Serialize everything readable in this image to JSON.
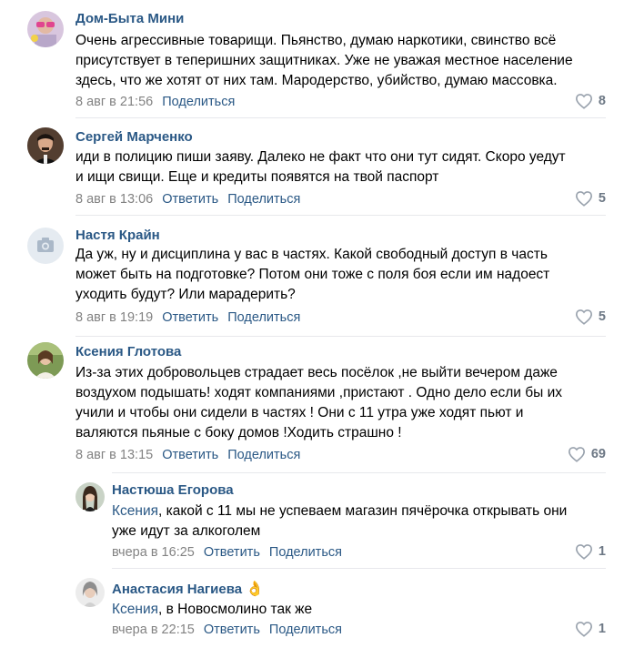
{
  "comments": [
    {
      "author": "Дом-Быта Мини",
      "lines": [
        "Очень агрессивные товарищи. Пьянство, думаю наркотики, свинство всё",
        "присутствует в теперишних защитниках. Уже не уважая местное население",
        "здесь, что же хотят от них там. Мародерство, убийство, думаю массовка."
      ],
      "date": "8 авг в 21:56",
      "share": "Поделиться",
      "likes": "8"
    },
    {
      "author": "Сергей Марченко",
      "lines": [
        "иди в полицию пиши заяву. Далеко не факт что они тут сидят. Скоро уедут",
        "и ищи свищи. Еще и кредиты появятся на твой паспорт"
      ],
      "date": "8 авг в 13:06",
      "reply": "Ответить",
      "share": "Поделиться",
      "likes": "5"
    },
    {
      "author": "Настя Крайн",
      "lines": [
        "Да уж, ну и дисциплина у вас в частях. Какой свободный доступ в часть",
        "может быть на подготовке? Потом они тоже с поля боя если им надоест",
        "уходить будут? Или марадерить?"
      ],
      "date": "8 авг в 19:19",
      "reply": "Ответить",
      "share": "Поделиться",
      "likes": "5"
    },
    {
      "author": "Ксения Глотова",
      "lines": [
        "Из-за этих добровольцев страдает весь посёлок ,не выйти вечером даже",
        "воздухом подышать! ходят компаниями ,пристают . Одно дело если бы их",
        "учили и чтобы они сидели в частях ! Они с 11 утра уже ходят пьют и",
        "валяются пьяные с боку домов !Ходить страшно !"
      ],
      "date": "8 авг в 13:15",
      "reply": "Ответить",
      "share": "Поделиться",
      "likes": "69"
    }
  ],
  "replies": [
    {
      "author": "Настюша Егорова",
      "reply_to": "Ксения",
      "line1_rest": ", какой с 11 мы не успеваем магазин пячёрочка открывать они",
      "line2": "уже идут за алкоголем",
      "date": "вчера в 16:25",
      "reply": "Ответить",
      "share": "Поделиться",
      "likes": "1"
    },
    {
      "author": "Анастасия Нагиева",
      "author_emoji": "👌",
      "reply_to": "Ксения",
      "line1_rest": ", в Новосмолино так же",
      "date": "вчера в 22:15",
      "reply": "Ответить",
      "share": "Поделиться",
      "likes": "1"
    }
  ],
  "colors": {
    "link": "#2a5885",
    "meta": "#828282",
    "likes": "#6d7885",
    "separator": "#e7e8ec"
  }
}
